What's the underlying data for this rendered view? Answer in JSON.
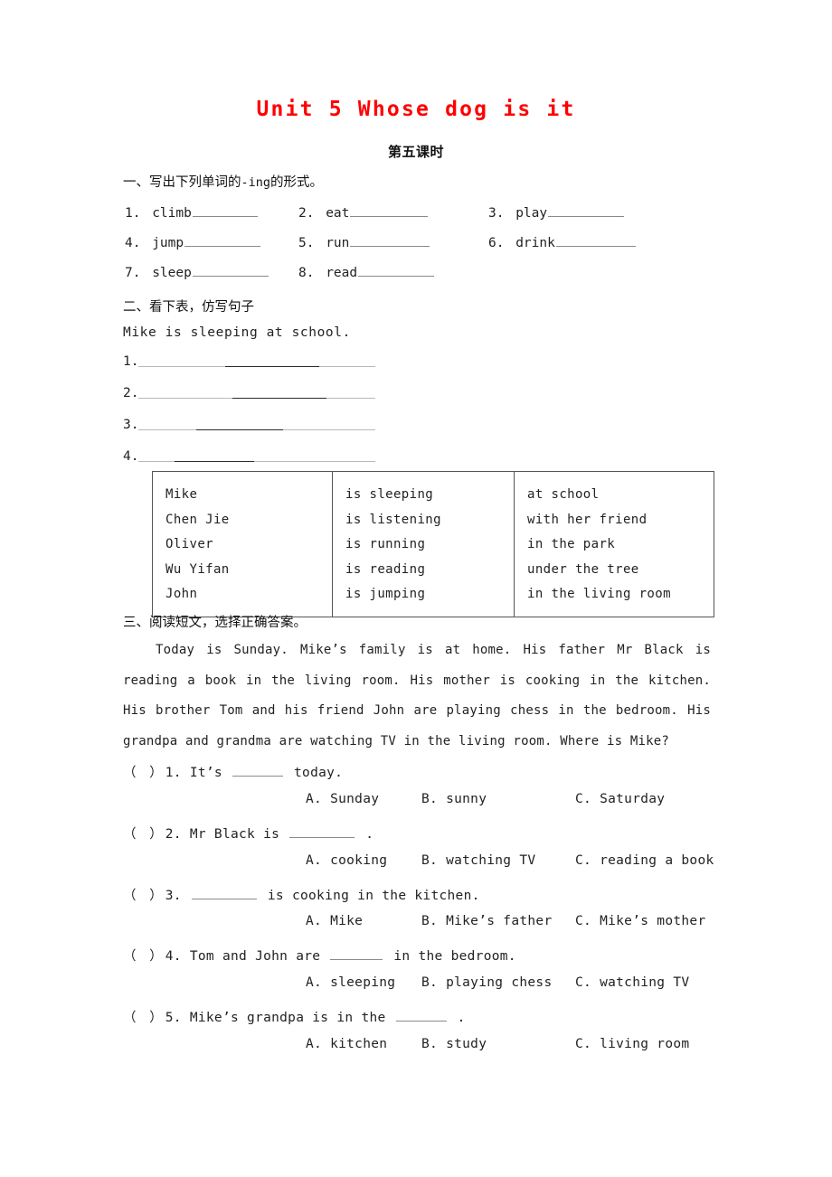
{
  "document": {
    "title": "Unit 5 Whose dog is it",
    "subtitle": "第五课时"
  },
  "section1": {
    "heading_cn": "一、写出下列单词的",
    "heading_en": "-ing",
    "heading_tail": "的形式。",
    "items": [
      {
        "num": "1.",
        "word": "climb",
        "blank_w": 72
      },
      {
        "num": "2.",
        "word": "eat",
        "blank_w": 86
      },
      {
        "num": "3.",
        "word": "play",
        "blank_w": 84
      },
      {
        "num": "4.",
        "word": "jump",
        "blank_w": 84
      },
      {
        "num": "5.",
        "word": "run",
        "blank_w": 88
      },
      {
        "num": "6.",
        "word": "drink",
        "blank_w": 88
      },
      {
        "num": "7.",
        "word": "sleep",
        "blank_w": 84
      },
      {
        "num": "8.",
        "word": "read",
        "blank_w": 84
      }
    ]
  },
  "section2": {
    "heading": "二、看下表，仿写句子",
    "model": "Mike is sleeping at school.",
    "lines": [
      {
        "label": "1."
      },
      {
        "label": "2."
      },
      {
        "label": "3."
      },
      {
        "label": "4."
      }
    ],
    "table": {
      "col1": [
        "Mike",
        "Chen Jie",
        "Oliver",
        "Wu Yifan",
        "John"
      ],
      "col2": [
        "is sleeping",
        "is listening",
        "is running",
        "is reading",
        "is jumping"
      ],
      "col3": [
        "at school",
        "with her friend",
        "in the park",
        "under the tree",
        "in the living room"
      ]
    }
  },
  "section3": {
    "heading": "三、阅读短文，选择正确答案。",
    "passage": "Today is Sunday. Mike’s family is at home. His father Mr Black is reading a book in the living room. His mother is cooking in the kitchen. His brother Tom and his friend John are playing chess in the bedroom. His grandpa and grandma are watching TV in the living room. Where is Mike?",
    "questions": [
      {
        "marker": "（  ）",
        "num": "1.",
        "stem_before": "It’s",
        "stem_after": "today.",
        "blank_w": 56,
        "options": [
          {
            "letter": "A.",
            "text": "Sunday"
          },
          {
            "letter": "B.",
            "text": "sunny"
          },
          {
            "letter": "C.",
            "text": "Saturday"
          }
        ]
      },
      {
        "marker": "（  ）",
        "num": "2.",
        "stem_before": "Mr Black is",
        "stem_after": ".",
        "blank_w": 72,
        "options": [
          {
            "letter": "A.",
            "text": "cooking"
          },
          {
            "letter": "B.",
            "text": "watching TV"
          },
          {
            "letter": "C.",
            "text": "reading a book"
          }
        ]
      },
      {
        "marker": "（  ）",
        "num": "3.",
        "stem_before": "",
        "stem_after": "is cooking in the kitchen.",
        "blank_w": 72,
        "options": [
          {
            "letter": "A.",
            "text": "Mike"
          },
          {
            "letter": "B.",
            "text": "Mike’s father"
          },
          {
            "letter": "C.",
            "text": "Mike’s mother"
          }
        ]
      },
      {
        "marker": "（  ）",
        "num": "4.",
        "stem_before": "Tom and John are",
        "stem_after": "in the bedroom.",
        "blank_w": 58,
        "options": [
          {
            "letter": "A.",
            "text": "sleeping"
          },
          {
            "letter": "B.",
            "text": "playing chess"
          },
          {
            "letter": "C.",
            "text": "watching TV"
          }
        ]
      },
      {
        "marker": "（  ）",
        "num": "5.",
        "stem_before": "Mike’s grandpa is in the",
        "stem_after": ".",
        "blank_w": 56,
        "options": [
          {
            "letter": "A.",
            "text": "kitchen"
          },
          {
            "letter": "B.",
            "text": "study"
          },
          {
            "letter": "C.",
            "text": "living room"
          }
        ]
      }
    ]
  },
  "colors": {
    "title_red": "#ff0000",
    "text": "#222222",
    "rule_light": "#b9b9b9",
    "rule_dark": "#2b2b2b",
    "table_border": "#555555"
  }
}
